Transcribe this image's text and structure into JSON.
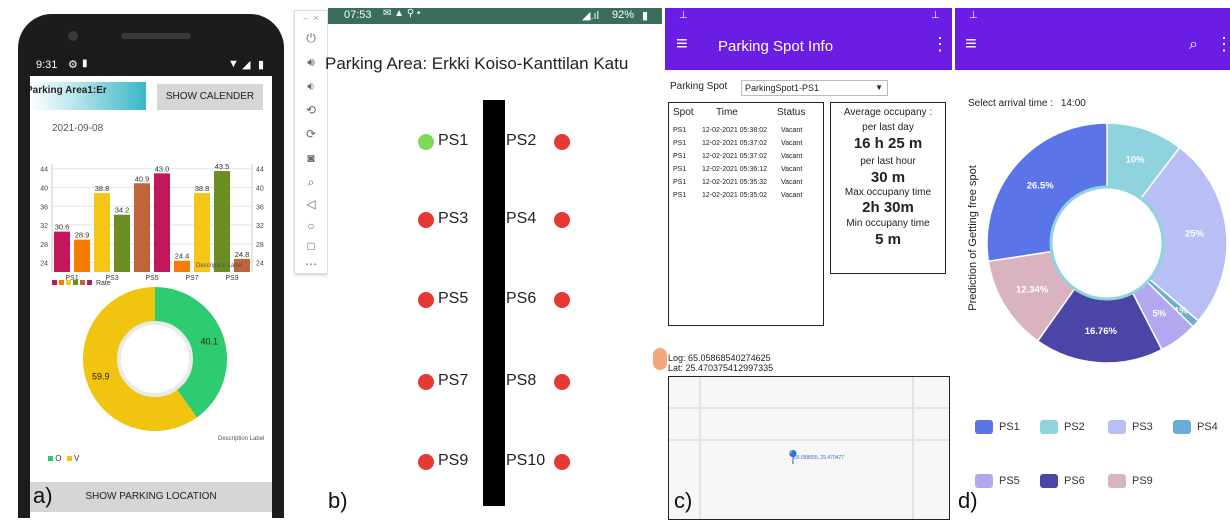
{
  "labels": {
    "a": "a)",
    "b": "b)",
    "c": "c)",
    "d": "d)"
  },
  "panel_a": {
    "status_time": "9:31",
    "area_title": "Parking Area1:Er",
    "show_calendar": "SHOW CALENDER",
    "date": "2021-09-08",
    "chart_data": {
      "type": "bar",
      "categories": [
        "PS1",
        "PS2",
        "PS3",
        "PS4",
        "PS5",
        "PS6",
        "PS7",
        "PS8",
        "PS9",
        "PS10"
      ],
      "x_tick_labels": [
        "PS1",
        "PS3",
        "PS5",
        "PS7",
        "PS9"
      ],
      "values": [
        30.6,
        28.9,
        38.8,
        34.2,
        40.9,
        43.0,
        24.4,
        38.8,
        43.5,
        24.8
      ],
      "value_labels": [
        "30.6",
        "28.9",
        "38.8",
        "34.2",
        "40.9",
        "43.0",
        "24.4",
        "38.8",
        "43.5",
        "24.8"
      ],
      "colors": [
        "#c2185b",
        "#f57c00",
        "#f5c518",
        "#6b8e23",
        "#c0643a",
        "#c2185b",
        "#f57c00",
        "#f5c518",
        "#6b8e23",
        "#c0643a"
      ],
      "y_ticks": [
        "24",
        "28",
        "32",
        "36",
        "40",
        "44"
      ],
      "ylim": [
        22,
        45
      ],
      "legend": "Rate",
      "description": "Description Label"
    },
    "donut": {
      "values": [
        40.1,
        59.9
      ],
      "labels": [
        "40.1",
        "59.9"
      ],
      "colors": [
        "#2ecc71",
        "#f1c40f"
      ],
      "legend": [
        "O",
        "V"
      ],
      "description": "Description Label"
    },
    "show_parking_location": "SHOW PARKING LOCATION"
  },
  "panel_b": {
    "status_time": "07:53",
    "battery": "92%",
    "title": "Parking Area: Erkki Koiso-Kanttilan Katu",
    "spots": [
      {
        "name": "PS1",
        "status_color": "#7ed957"
      },
      {
        "name": "PS2",
        "status_color": "#e53935"
      },
      {
        "name": "PS3",
        "status_color": "#e53935"
      },
      {
        "name": "PS4",
        "status_color": "#e53935"
      },
      {
        "name": "PS5",
        "status_color": "#e53935"
      },
      {
        "name": "PS6",
        "status_color": "#e53935"
      },
      {
        "name": "PS7",
        "status_color": "#e53935"
      },
      {
        "name": "PS8",
        "status_color": "#e53935"
      },
      {
        "name": "PS9",
        "status_color": "#e53935"
      },
      {
        "name": "PS10",
        "status_color": "#e53935"
      }
    ]
  },
  "panel_c": {
    "app_title": "Parking Spot Info",
    "spot_label": "Parking Spot",
    "spot_value": "ParkingSpot1-PS1",
    "table": {
      "headers": [
        "Spot",
        "Time",
        "Status"
      ],
      "rows": [
        [
          "PS1",
          "12-02-2021 05:38:02",
          "Vacant"
        ],
        [
          "PS1",
          "12-02-2021 05:37:02",
          "Vacant"
        ],
        [
          "PS1",
          "12-02-2021 05:37:02",
          "Vacant"
        ],
        [
          "PS1",
          "12-02-2021 05:36:12",
          "Vacant"
        ],
        [
          "PS1",
          "12-02-2021 05:35:32",
          "Vacant"
        ],
        [
          "PS1",
          "12-02-2021 05:35:02",
          "Vacant"
        ]
      ]
    },
    "stats": {
      "avg_title": "Average occupany :",
      "per_day_label": "per last day",
      "per_day_value": "16 h 25 m",
      "per_hour_label": "per last hour",
      "per_hour_value": "30 m",
      "max_label": "Max occupany time",
      "max_value": "2h 30m",
      "min_label": "Min occupany time",
      "min_value": "5 m"
    },
    "log_line": "Log: 65.05868540274625",
    "lat_line": "Lat:  25.470375412997335",
    "map_marker_text": "65.058655, 25.470477"
  },
  "panel_d": {
    "arrival_label": "Select arrival time :",
    "arrival_value": "14:00",
    "y_axis_label": "Prediction of Getting free spot",
    "chart_data": {
      "type": "pie",
      "donut": true,
      "slices": [
        {
          "label": "PS2",
          "value": 10,
          "text": "10%",
          "color": "#8fd3df"
        },
        {
          "label": "PS3",
          "value": 25,
          "text": "25%",
          "color": "#b7bff5"
        },
        {
          "label": "PS4",
          "value": 1,
          "text": "1%",
          "color": "#6aaed6"
        },
        {
          "label": "PS5",
          "value": 5,
          "text": "5%",
          "color": "#b3a8ef"
        },
        {
          "label": "PS6",
          "value": 16.76,
          "text": "16.76%",
          "color": "#4b45a8"
        },
        {
          "label": "PS9",
          "value": 12.34,
          "text": "12.34%",
          "color": "#d9b3c0"
        },
        {
          "label": "PS1",
          "value": 26.5,
          "text": "26.5%",
          "color": "#5b74e8"
        }
      ]
    },
    "legend": [
      {
        "label": "PS1",
        "color": "#5b74e8"
      },
      {
        "label": "PS2",
        "color": "#8fd3df"
      },
      {
        "label": "PS3",
        "color": "#b7bff5"
      },
      {
        "label": "PS4",
        "color": "#6aaed6"
      },
      {
        "label": "PS5",
        "color": "#b3a8ef"
      },
      {
        "label": "PS6",
        "color": "#4b45a8"
      },
      {
        "label": "PS9",
        "color": "#d9b3c0"
      }
    ]
  },
  "icons": {
    "menu": "hamburger-icon",
    "more": "more-vert-icon",
    "search": "search-icon",
    "pin": "pin-icon",
    "map_marker": "map-marker-icon"
  }
}
